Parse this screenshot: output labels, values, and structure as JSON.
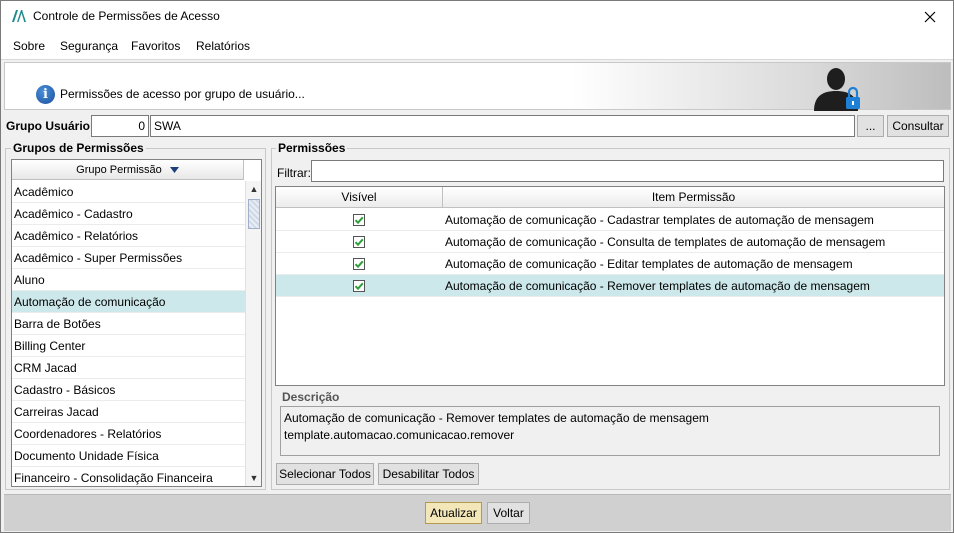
{
  "window": {
    "title": "Controle de Permissões de Acesso"
  },
  "menu": [
    "Sobre",
    "Segurança",
    "Favoritos",
    "Relatórios"
  ],
  "banner": {
    "text": "Permissões de acesso por grupo de usuário..."
  },
  "grupo_usuario": {
    "label": "Grupo Usuário:",
    "code": "0",
    "name": "SWA",
    "browse_label": "...",
    "consult_label": "Consultar"
  },
  "grupos": {
    "title": "Grupos de Permissões",
    "column_header": "Grupo Permissão",
    "items": [
      "Acadêmico",
      "Acadêmico - Cadastro",
      "Acadêmico - Relatórios",
      "Acadêmico - Super Permissões",
      "Aluno",
      "Automação de comunicação",
      "Barra de Botões",
      "Billing Center",
      "CRM Jacad",
      "Cadastro - Básicos",
      "Carreiras Jacad",
      "Coordenadores - Relatórios",
      "Documento Unidade Física",
      "Financeiro - Consolidação Financeira"
    ],
    "selected_index": 5
  },
  "permissoes": {
    "title": "Permissões",
    "filter_label": "Filtrar:",
    "filter_value": "",
    "col_visible": "Visível",
    "col_item": "Item Permissão",
    "rows": [
      {
        "visible": true,
        "item": "Automação de comunicação - Cadastrar templates de automação de mensagem"
      },
      {
        "visible": true,
        "item": "Automação de comunicação - Consulta de templates de automação de mensagem"
      },
      {
        "visible": true,
        "item": "Automação de comunicação - Editar templates de automação de mensagem"
      },
      {
        "visible": true,
        "item": "Automação de comunicação - Remover templates de automação de mensagem"
      }
    ],
    "selected_index": 3
  },
  "descricao": {
    "title": "Descrição",
    "line1": "Automação de comunicação - Remover templates de automação de mensagem",
    "line2": "template.automacao.comunicacao.remover"
  },
  "buttons": {
    "select_all": "Selecionar Todos",
    "disable_all": "Desabilitar Todos",
    "atualizar": "Atualizar",
    "voltar": "Voltar"
  },
  "colors": {
    "selection": "#cde8ea",
    "check": "#2e9e3a",
    "app_logo": "#1f8a8a"
  }
}
